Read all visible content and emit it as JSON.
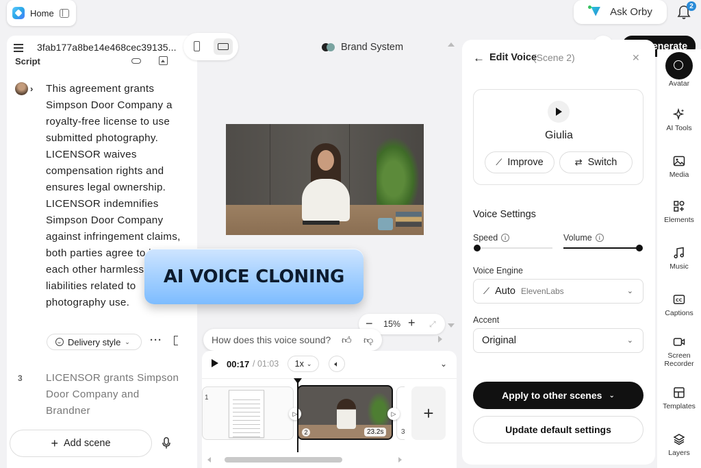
{
  "topbar": {
    "home_label": "Home",
    "ask_orby_label": "Ask Orby",
    "notification_count": "2"
  },
  "script_panel": {
    "project_id": "3fab177a8be14e468cec39135...",
    "script_label": "Script",
    "scene2_text": "This agreement grants Simpson Door Company a royalty-free license to use submitted photography. LICENSOR waives compensation rights and ensures legal ownership. LICENSOR indemnifies Simpson Door Company against infringement claims, both parties agree to hold each other harmless from liabilities related to photography use.",
    "delivery_style_label": "Delivery style",
    "scene3_number": "3",
    "scene3_text": "LICENSOR grants Simpson Door Company and Brandner",
    "add_scene_label": "Add scene"
  },
  "canvas": {
    "brand_system_label": "Brand System",
    "banner_text": "AI VOICE CLONING",
    "zoom_level": "15%",
    "feedback_prompt": "How does this voice sound?"
  },
  "timeline": {
    "current_time": "00:17",
    "total_time": "/ 01:03",
    "playback_speed": "1x",
    "clips": [
      {
        "number": "1"
      },
      {
        "number": "2",
        "duration": "23.2s"
      },
      {
        "number": "3"
      }
    ]
  },
  "header_actions": {
    "generate_label": "Generate"
  },
  "edit_voice": {
    "title": "Edit Voice",
    "scene_ref": "(Scene 2)",
    "voice_name": "Giulia",
    "improve_label": "Improve",
    "switch_label": "Switch",
    "voice_settings_title": "Voice Settings",
    "speed_label": "Speed",
    "speed_value": 0.0,
    "volume_label": "Volume",
    "volume_value": 1.0,
    "voice_engine_label": "Voice Engine",
    "voice_engine_value": "Auto",
    "voice_engine_provider": "ElevenLabs",
    "accent_label": "Accent",
    "accent_value": "Original",
    "apply_label": "Apply to other scenes",
    "update_default_label": "Update default settings"
  },
  "tool_rail": [
    {
      "label": "Avatar",
      "icon": "avatar-icon"
    },
    {
      "label": "AI Tools",
      "icon": "sparkle-icon"
    },
    {
      "label": "Media",
      "icon": "image-icon"
    },
    {
      "label": "Elements",
      "icon": "elements-icon"
    },
    {
      "label": "Music",
      "icon": "music-note-icon"
    },
    {
      "label": "Captions",
      "icon": "captions-icon"
    },
    {
      "label": "Screen Recorder",
      "icon": "screen-recorder-icon"
    },
    {
      "label": "Templates",
      "icon": "templates-icon"
    },
    {
      "label": "Layers",
      "icon": "layers-icon"
    }
  ]
}
